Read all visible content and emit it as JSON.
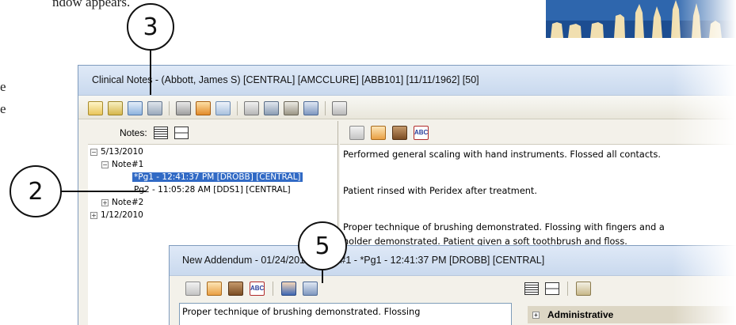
{
  "doc": {
    "fragment": "ndow appears.",
    "margin_e1": "e",
    "margin_e2": "e"
  },
  "callouts": {
    "c3": "3",
    "c2": "2",
    "c5": "5"
  },
  "main_window": {
    "title": "Clinical Notes - (Abbott, James S) [CENTRAL] [AMCCLURE] [ABB101] [11/11/1962] [50]",
    "notes_label": "Notes:",
    "tree": [
      {
        "label": "5/13/2010",
        "expander": "−"
      },
      {
        "label": "Note#1",
        "expander": "−"
      },
      {
        "label": "*Pg1 - 12:41:37 PM [DROBB] [CENTRAL]"
      },
      {
        "label": "Pg2 - 11:05:28 AM [DDS1] [CENTRAL]"
      },
      {
        "label": "Note#2",
        "expander": "+"
      },
      {
        "label": "1/12/2010",
        "expander": "+"
      }
    ],
    "note_lines": [
      "Performed general scaling with hand instruments. Flossed all contacts.",
      "Patient rinsed with Peridex after treatment.",
      "Proper technique of brushing demonstrated.  Flossing with fingers and a",
      "holder demonstrated.  Patient given a soft toothbrush and floss."
    ]
  },
  "addendum_window": {
    "title": "New Addendum - 01/24/2012 - Note#1 - *Pg1 - 12:41:37 PM [DROBB] [CENTRAL]",
    "text": "Proper technique of brushing demonstrated.  Flossing",
    "admin_label": "Administrative",
    "admin_expander": "+"
  },
  "colors": {
    "selection": "#316ac5",
    "titlebar": "#c9d9ee",
    "window_bg": "#f3f1ea"
  },
  "icons": [
    "toolbar-note-icon",
    "new-note-icon",
    "addendum-icon",
    "print-icon",
    "spell-check-icon",
    "cut-icon",
    "copy-icon",
    "paste-icon",
    "user-icon",
    "dental-chart-icon"
  ]
}
